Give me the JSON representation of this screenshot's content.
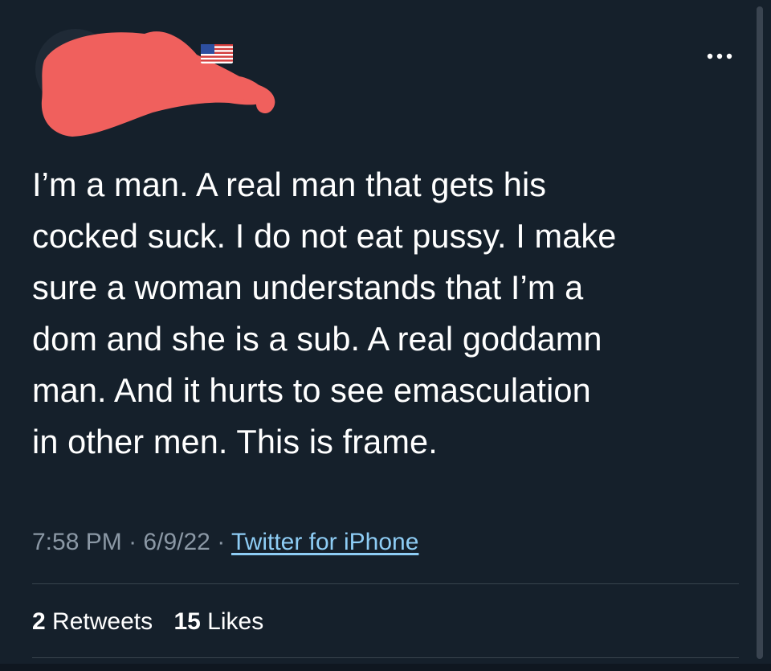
{
  "tweet": {
    "text": "I’m a man. A real man that gets his\ncocked suck. I do not eat pussy. I make\nsure a woman understands that I’m a\ndom and she is a sub. A real goddamn\nman. And it hurts to see emasculation\nin other men. This is frame.",
    "time": "7:58 PM",
    "date": "6/9/22",
    "separator": "·",
    "source": "Twitter for iPhone",
    "retweets_count": "2",
    "retweets_label": "Retweets",
    "likes_count": "15",
    "likes_label": "Likes"
  },
  "icons": {
    "more": "more-horizontal-icon",
    "flag": "us-flag-icon"
  },
  "colors": {
    "background": "#15202b",
    "text": "#ffffff",
    "muted": "#8b98a5",
    "link": "#8ecdf5",
    "divider": "#38444d",
    "redaction": "#f0605d"
  }
}
